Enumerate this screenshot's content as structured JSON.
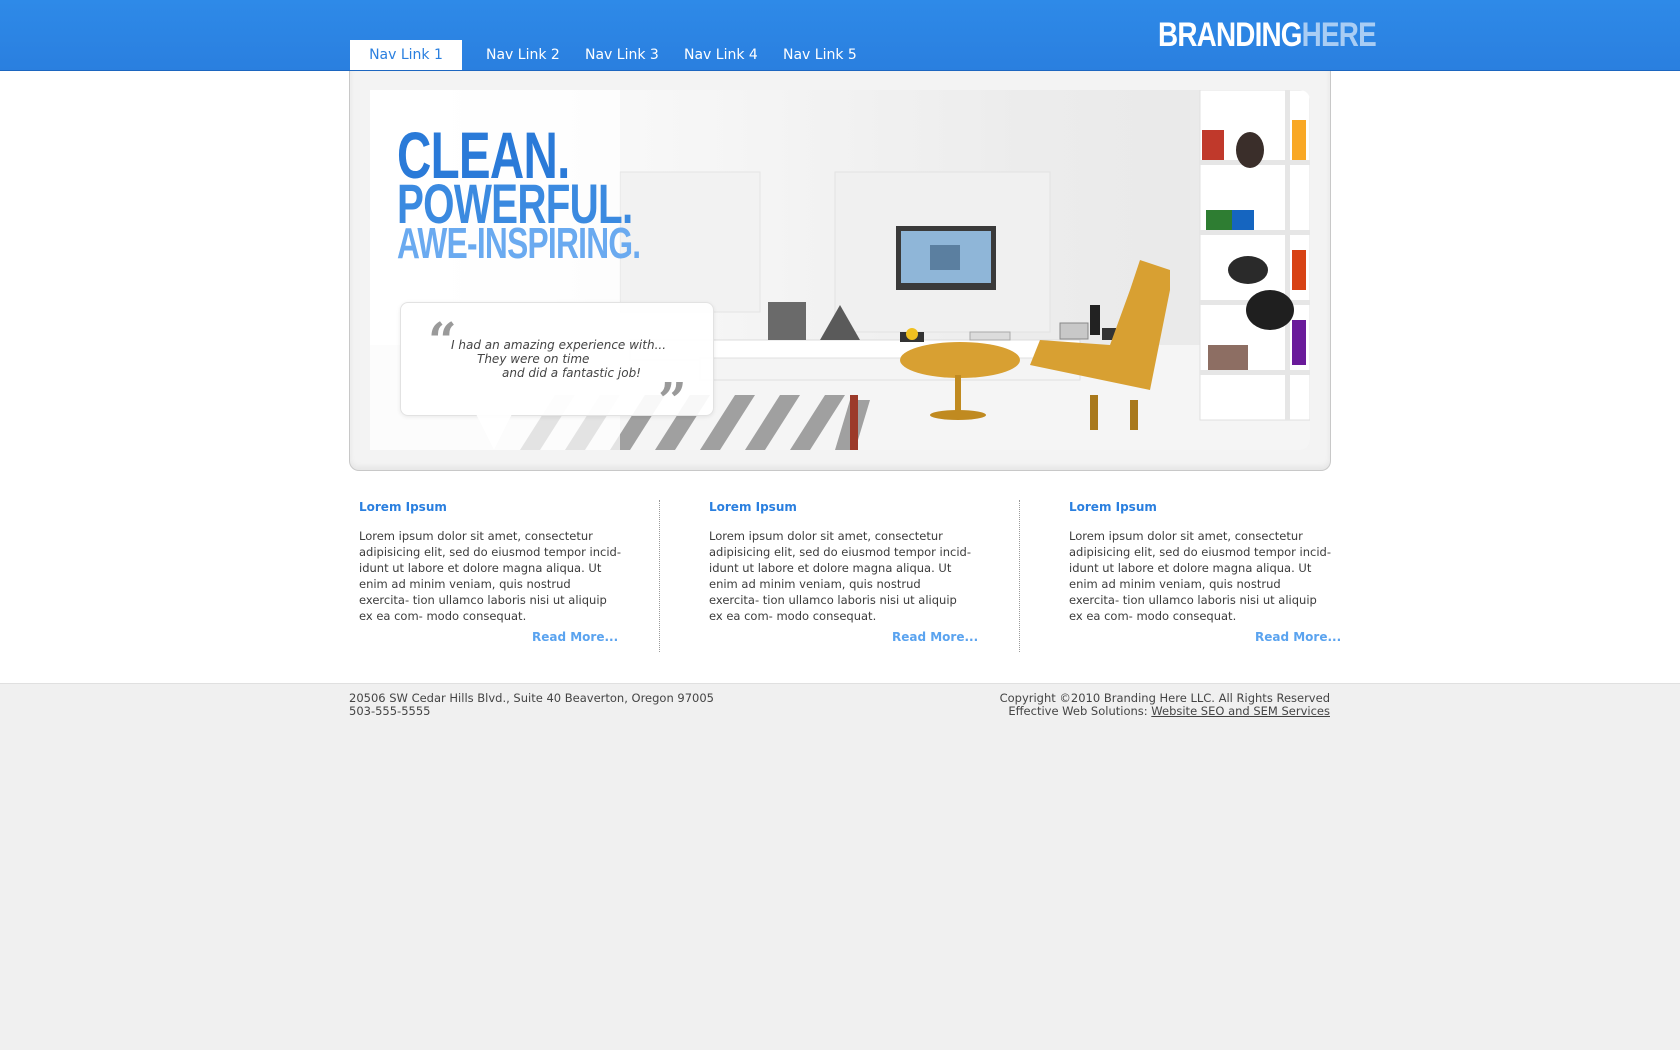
{
  "nav": {
    "links": [
      "Nav Link 1",
      "Nav Link 2",
      "Nav Link 3",
      "Nav Link 4",
      "Nav Link 5"
    ],
    "active_index": 0
  },
  "brand": {
    "part1": "BRANDING",
    "part2": "HERE"
  },
  "hero": {
    "headline1": "CLEAN.",
    "headline2": "POWERFUL.",
    "headline3": "AWE-INSPIRING.",
    "quote_lines": [
      "I had an amazing experience with...",
      "They were on time",
      "and did a fantastic job!"
    ]
  },
  "columns": [
    {
      "title": "Lorem Ipsum",
      "body": "Lorem ipsum dolor sit amet, consectetur adipisicing elit, sed do eiusmod tempor incid- idunt ut labore et dolore magna aliqua. Ut enim ad minim veniam, quis nostrud exercita- tion ullamco laboris nisi ut aliquip ex ea com- modo consequat.",
      "read_more": "Read More..."
    },
    {
      "title": "Lorem Ipsum",
      "body": "Lorem ipsum dolor sit amet, consectetur adipisicing elit, sed do eiusmod tempor incid- idunt ut labore et dolore magna aliqua. Ut enim ad minim veniam, quis nostrud exercita- tion ullamco laboris nisi ut aliquip ex ea com- modo consequat.",
      "read_more": "Read More..."
    },
    {
      "title": "Lorem Ipsum",
      "body": "Lorem ipsum dolor sit amet, consectetur adipisicing elit, sed do eiusmod tempor incid- idunt ut labore et dolore magna aliqua. Ut enim ad minim veniam, quis nostrud exercita- tion ullamco laboris nisi ut aliquip ex ea com- modo consequat.",
      "read_more": "Read More..."
    }
  ],
  "footer": {
    "address": "20506 SW Cedar Hills Blvd., Suite 40 Beaverton, Oregon 97005",
    "phone": "503-555-5555",
    "copyright": "Copyright ©2010 Branding Here LLC. All Rights Reserved",
    "solutions_label": "Effective Web Solutions:",
    "solutions_link": "Website SEO and SEM Services"
  },
  "colors": {
    "accent": "#2a7fdf",
    "read_more": "#5aa3ef",
    "chair": "#d8a032"
  }
}
